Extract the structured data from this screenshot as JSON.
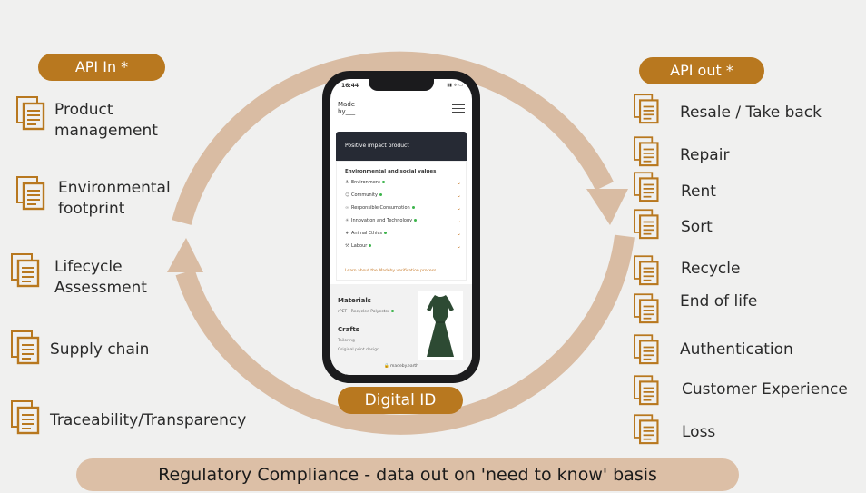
{
  "api_in": {
    "label": "API In *",
    "items": [
      {
        "label": "Product\nmanagement"
      },
      {
        "label": "Environmental\nfootprint"
      },
      {
        "label": "Lifecycle\nAssessment"
      },
      {
        "label": "Supply chain"
      },
      {
        "label": "Traceability/Transparency"
      }
    ]
  },
  "api_out": {
    "label": "API out *",
    "items": [
      {
        "label": "Resale / Take back"
      },
      {
        "label": "Repair"
      },
      {
        "label": "Rent"
      },
      {
        "label": "Sort"
      },
      {
        "label": "Recycle"
      },
      {
        "label": "End of life"
      },
      {
        "label": "Authentication"
      },
      {
        "label": "Customer Experience"
      },
      {
        "label": "Loss"
      }
    ]
  },
  "center": {
    "label": "Digital ID"
  },
  "banner": {
    "text": "Regulatory Compliance - data out on 'need to know' basis"
  },
  "phone": {
    "time": "16:44",
    "status_icons": "▮▮ ≑ ▭",
    "logo": "Made\nby___",
    "card_header": "Positive impact product",
    "values_title": "Environmental and social values",
    "values": [
      {
        "label": "Environment",
        "icon": "leaf-icon"
      },
      {
        "label": "Community",
        "icon": "people-icon"
      },
      {
        "label": "Responsible Consumption",
        "icon": "infinity-icon"
      },
      {
        "label": "Innovation and Technology",
        "icon": "bulb-icon"
      },
      {
        "label": "Animal Ethics",
        "icon": "paw-icon"
      },
      {
        "label": "Labour",
        "icon": "tools-icon"
      }
    ],
    "learn_link": "Learn about the Madeby verification process",
    "materials_title": "Materials",
    "materials_value": "rPET - Recycled Polyester",
    "crafts_title": "Crafts",
    "crafts": [
      "Tailoring",
      "Original print design"
    ],
    "url": "🔒 madeby.earth"
  },
  "colors": {
    "accent": "#b8781f",
    "arrow": "#d9bca3",
    "banner": "#dcbfa6",
    "background": "#f0f0ef"
  }
}
